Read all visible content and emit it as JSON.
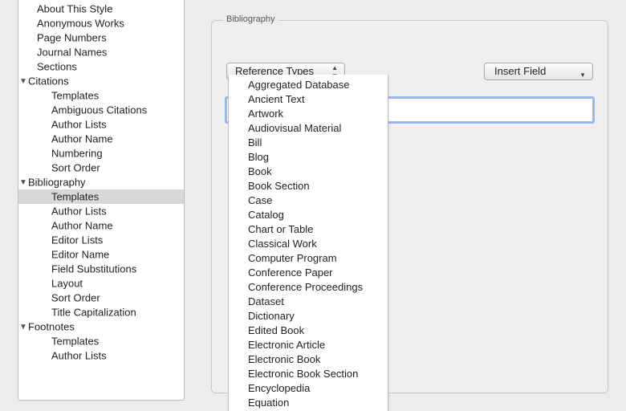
{
  "sidebar": {
    "items": [
      {
        "label": "About This Style",
        "depth": 1,
        "expandable": false
      },
      {
        "label": "Anonymous Works",
        "depth": 1,
        "expandable": false
      },
      {
        "label": "Page Numbers",
        "depth": 1,
        "expandable": false
      },
      {
        "label": "Journal Names",
        "depth": 1,
        "expandable": false
      },
      {
        "label": "Sections",
        "depth": 1,
        "expandable": false
      },
      {
        "label": "Citations",
        "depth": 1,
        "expandable": true,
        "expanded": true
      },
      {
        "label": "Templates",
        "depth": 2,
        "expandable": false
      },
      {
        "label": "Ambiguous Citations",
        "depth": 2,
        "expandable": false
      },
      {
        "label": "Author Lists",
        "depth": 2,
        "expandable": false
      },
      {
        "label": "Author Name",
        "depth": 2,
        "expandable": false
      },
      {
        "label": "Numbering",
        "depth": 2,
        "expandable": false
      },
      {
        "label": "Sort Order",
        "depth": 2,
        "expandable": false
      },
      {
        "label": "Bibliography",
        "depth": 1,
        "expandable": true,
        "expanded": true
      },
      {
        "label": "Templates",
        "depth": 2,
        "expandable": false,
        "selected": true
      },
      {
        "label": "Author Lists",
        "depth": 2,
        "expandable": false
      },
      {
        "label": "Author Name",
        "depth": 2,
        "expandable": false
      },
      {
        "label": "Editor Lists",
        "depth": 2,
        "expandable": false
      },
      {
        "label": "Editor Name",
        "depth": 2,
        "expandable": false
      },
      {
        "label": "Field Substitutions",
        "depth": 2,
        "expandable": false
      },
      {
        "label": "Layout",
        "depth": 2,
        "expandable": false
      },
      {
        "label": "Sort Order",
        "depth": 2,
        "expandable": false
      },
      {
        "label": "Title Capitalization",
        "depth": 2,
        "expandable": false
      },
      {
        "label": "Footnotes",
        "depth": 1,
        "expandable": true,
        "expanded": true
      },
      {
        "label": "Templates",
        "depth": 2,
        "expandable": false
      },
      {
        "label": "Author Lists",
        "depth": 2,
        "expandable": false
      }
    ]
  },
  "panel": {
    "title": "Bibliography",
    "reference_types_label": "Reference Types",
    "insert_field_label": "Insert Field"
  },
  "dropdown": {
    "items": [
      "Aggregated Database",
      "Ancient Text",
      "Artwork",
      "Audiovisual Material",
      "Bill",
      "Blog",
      "Book",
      "Book Section",
      "Case",
      "Catalog",
      "Chart or Table",
      "Classical Work",
      "Computer Program",
      "Conference Paper",
      "Conference Proceedings",
      "Dataset",
      "Dictionary",
      "Edited Book",
      "Electronic Article",
      "Electronic Book",
      "Electronic Book Section",
      "Encyclopedia",
      "Equation"
    ]
  }
}
